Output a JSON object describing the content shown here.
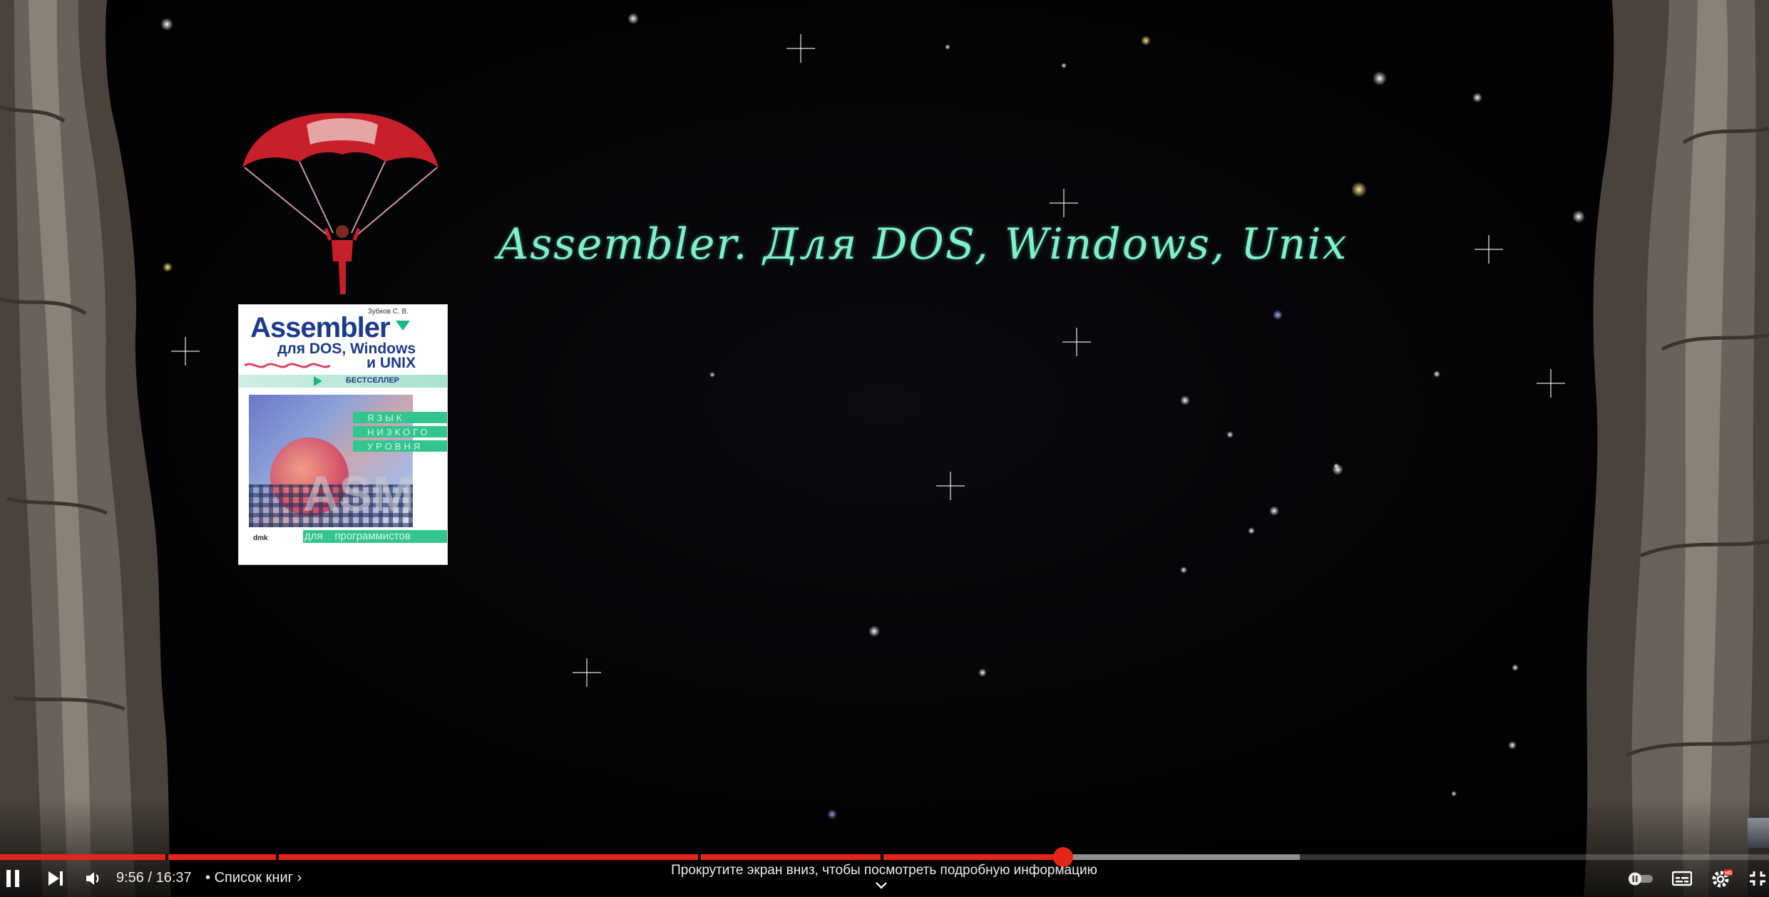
{
  "video": {
    "title_overlay": "Assembler. Для DOS, Windows, Unix",
    "book": {
      "author": "Зубков С. В.",
      "title": "Assembler",
      "subtitle_line1": "для DOS, Windows",
      "subtitle_line2": "и UNIX",
      "badge": "БЕСТСЕЛЛЕР",
      "stripe1": "ЯЗЫК",
      "stripe2": "НИЗКОГО",
      "stripe3": "УРОВНЯ",
      "big_text": "ASM",
      "bottom_prefix": "для",
      "bottom_text": "программистов",
      "publisher": "dmk"
    }
  },
  "player": {
    "progress": {
      "played_fraction": 0.6009,
      "loaded_fraction": 0.7346,
      "chapter_marks": [
        0.0935,
        0.1559,
        0.3948,
        0.4976
      ]
    },
    "time_current": "9:56",
    "time_total": "16:37",
    "time_separator": " / ",
    "chapter_bullet": "•",
    "chapter_title": "Список книг",
    "chapter_chevron": "›",
    "scroll_hint": "Прокрутите экран вниз, чтобы посмотреть подробную информацию",
    "hd_badge": "HD",
    "accent_color": "#e4261a",
    "icons": [
      "pause-icon",
      "next-icon",
      "volume-icon",
      "autoplay-toggle-icon",
      "subtitles-icon",
      "settings-icon",
      "exit-fullscreen-icon",
      "chevron-down-icon"
    ]
  }
}
